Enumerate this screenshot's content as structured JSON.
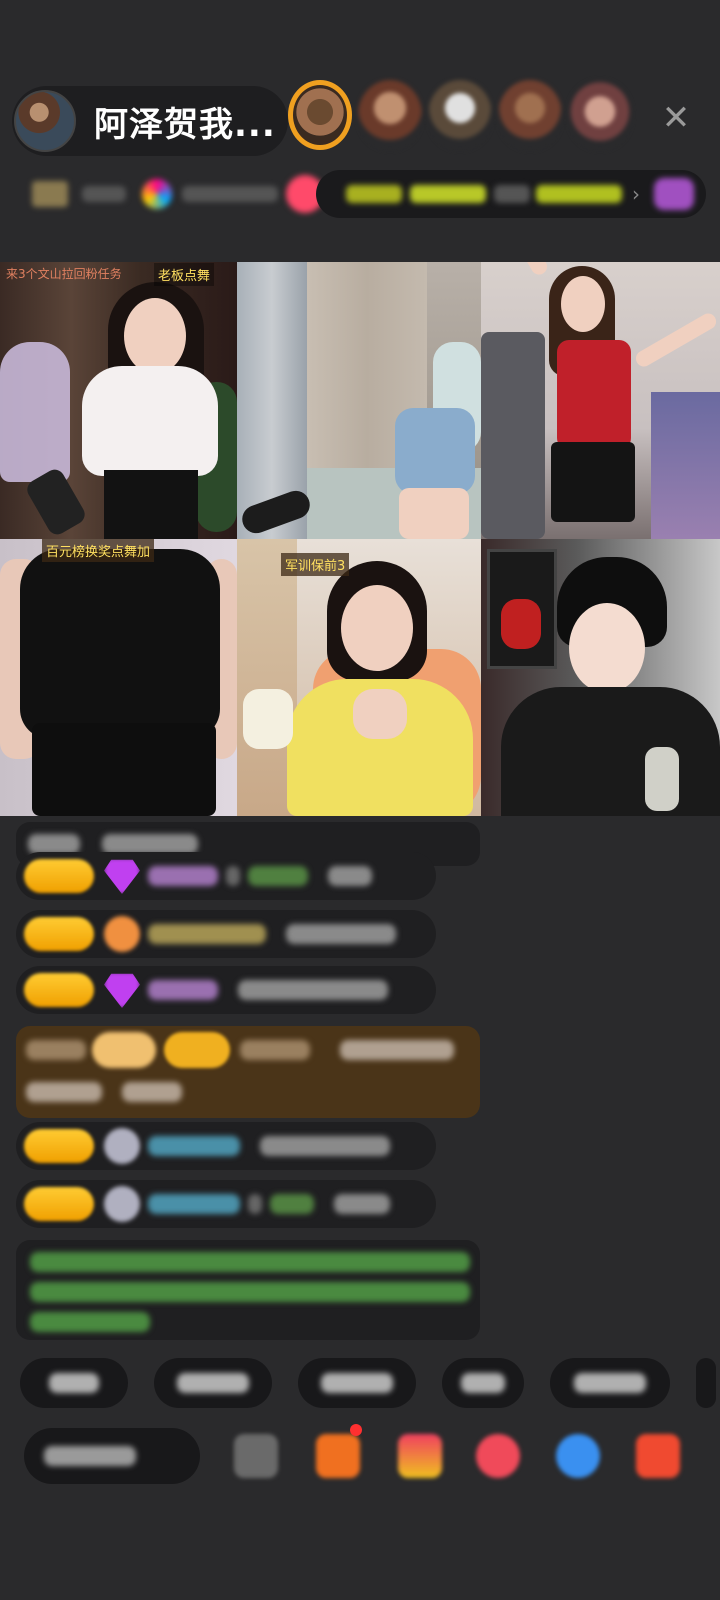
{
  "header": {
    "host_name": "阿泽贺我...",
    "close_label": "✕",
    "more_label": "›"
  },
  "grid": {
    "tile_1": {
      "tag": "来3个文山拉回粉任务",
      "label": "老板点舞"
    },
    "tile_4": {
      "label": "百元榜换奖点舞加"
    },
    "tile_5": {
      "label": "军训保前3"
    }
  },
  "chat": {
    "messages": [
      "row-1",
      "row-2",
      "row-3",
      "row-4",
      "gift",
      "row-5",
      "row-6"
    ]
  },
  "colors": {
    "background": "#2a2a2c",
    "pill": "#1f1f21",
    "level_badge": "#f0a000",
    "gift_banner": "#4a3418",
    "label_yellow": "#ffe060"
  }
}
